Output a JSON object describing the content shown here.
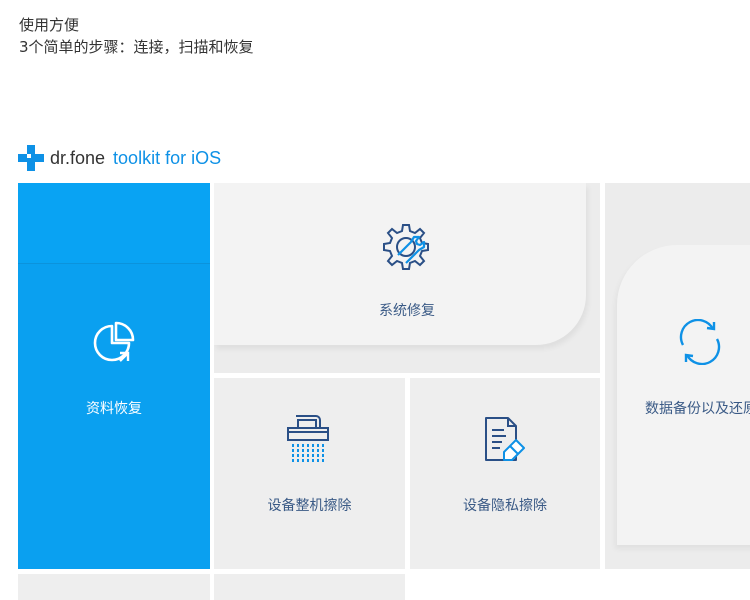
{
  "intro": {
    "line1": "使用方便",
    "line2": "3个简单的步骤：连接，扫描和恢复"
  },
  "logo": {
    "brand": "dr.fone",
    "product": "toolkit for iOS",
    "accent_color": "#0e91e6"
  },
  "tiles": {
    "recover": {
      "label": "资料恢复",
      "icon": "pie-chart-icon",
      "color": "#0aa0f0"
    },
    "repair": {
      "label": "系统修复",
      "icon": "gear-wrench-icon"
    },
    "wipe": {
      "label": "设备整机擦除",
      "icon": "shredder-icon"
    },
    "private_wipe": {
      "label": "设备隐私擦除",
      "icon": "document-eraser-icon"
    },
    "backup": {
      "label": "数据备份以及还原",
      "icon": "sync-icon"
    }
  }
}
